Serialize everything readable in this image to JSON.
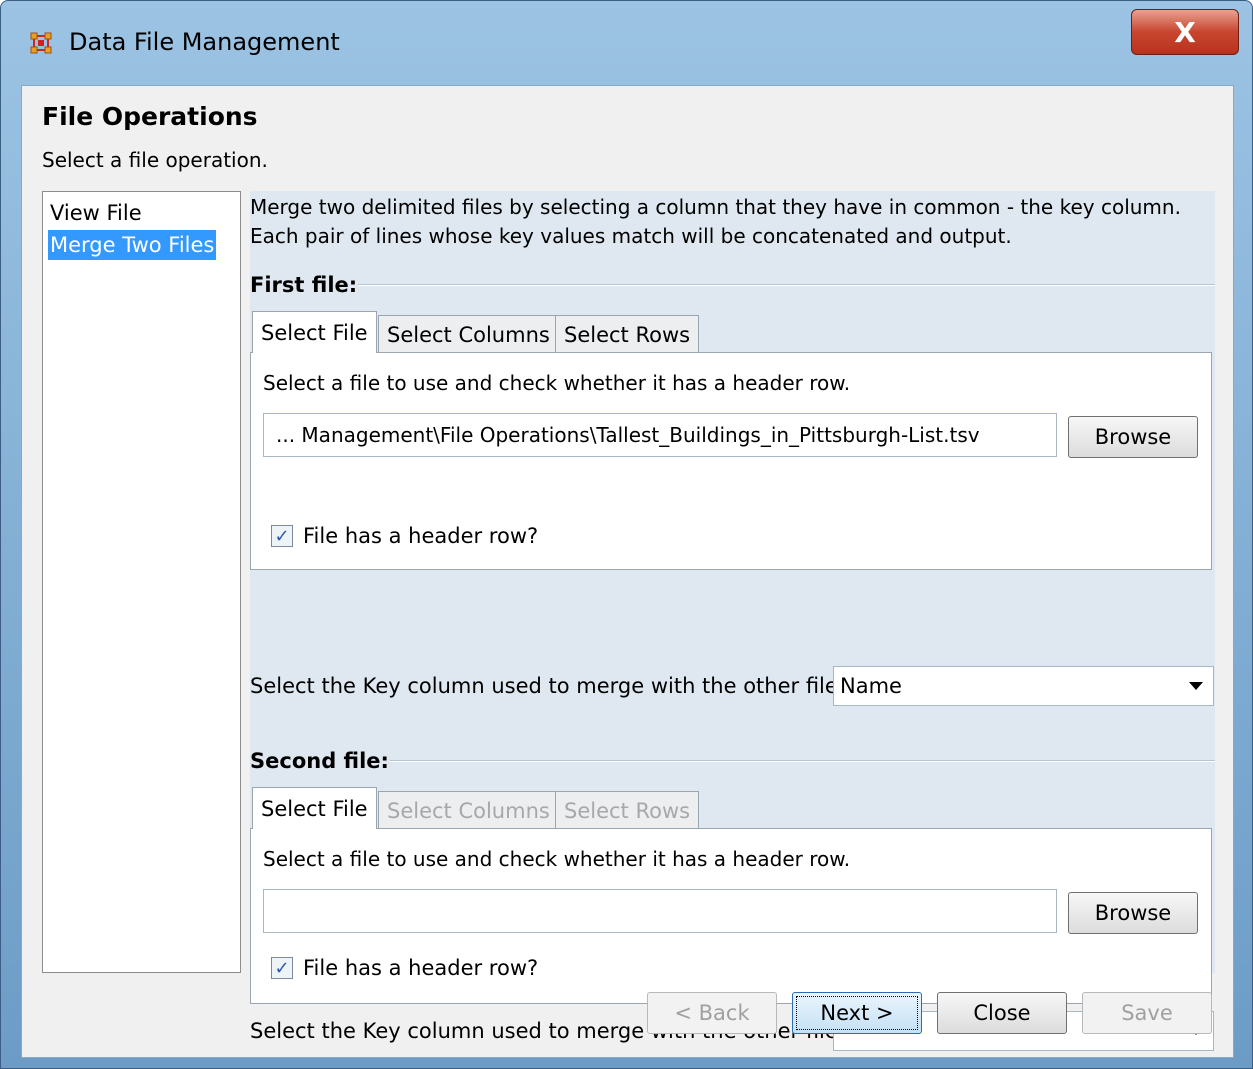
{
  "window": {
    "title": "Data File Management",
    "close_glyph": "X"
  },
  "page": {
    "heading": "File Operations",
    "subheading": "Select a file operation."
  },
  "operations": [
    {
      "label": "View File",
      "selected": false
    },
    {
      "label": "Merge Two Files",
      "selected": true
    }
  ],
  "merge": {
    "description_line1": "Merge two delimited files by selecting a column that they have in common - the key column.",
    "description_line2": "Each pair of lines whose key values match will be concatenated and output.",
    "first": {
      "section_label": "First file:",
      "tabs": [
        "Select File",
        "Select Columns",
        "Select Rows"
      ],
      "instruction": "Select a file to use and check whether it has a header row.",
      "file_path": "... Management\\File Operations\\Tallest_Buildings_in_Pittsburgh-List.tsv",
      "browse_label": "Browse",
      "header_checkbox_label": "File has a header row?",
      "header_checked": true,
      "key_label": "Select the Key column used to merge with the other file:",
      "key_value": "Name"
    },
    "second": {
      "section_label": "Second file:",
      "tabs": [
        "Select File",
        "Select Columns",
        "Select Rows"
      ],
      "instruction": "Select a file to use and check whether it has a header row.",
      "file_path": "",
      "browse_label": "Browse",
      "header_checkbox_label": "File has a header row?",
      "header_checked": true,
      "key_label": "Select the Key column used to merge with the other file:",
      "key_value": ""
    }
  },
  "footer": {
    "back_label": "< Back",
    "next_label": "Next >",
    "close_label": "Close",
    "save_label": "Save"
  },
  "colors": {
    "selection": "#3399ff",
    "titlebar": "#6c9cc6",
    "close_button": "#c8452e"
  }
}
